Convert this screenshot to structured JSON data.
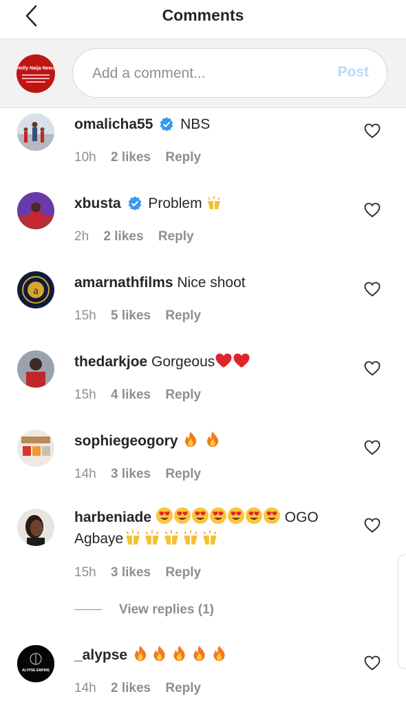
{
  "header": {
    "title": "Comments",
    "back_icon": "back-arrow-icon"
  },
  "compose": {
    "avatar_text": "Holly Naija News",
    "placeholder": "Add a comment...",
    "post_label": "Post",
    "post_color": "#b3dbff"
  },
  "comments": [
    {
      "username": "omalicha55",
      "verified": true,
      "text": "NBS",
      "emoji": [],
      "time": "10h",
      "likes": "2 likes",
      "reply": "Reply"
    },
    {
      "username": "xbusta",
      "verified": true,
      "text": "Problem",
      "emoji": [
        "raising-hands"
      ],
      "time": "2h",
      "likes": "2 likes",
      "reply": "Reply"
    },
    {
      "username": "amarnathfilms",
      "verified": false,
      "text": "Nice shoot",
      "emoji": [],
      "time": "15h",
      "likes": "5 likes",
      "reply": "Reply"
    },
    {
      "username": "thedarkjoe",
      "verified": false,
      "text": "Gorgeous",
      "emoji": [
        "red-heart",
        "red-heart"
      ],
      "time": "15h",
      "likes": "4 likes",
      "reply": "Reply"
    },
    {
      "username": "sophiegeogory",
      "verified": false,
      "text": "",
      "emoji": [
        "fire",
        "fire"
      ],
      "time": "14h",
      "likes": "3 likes",
      "reply": "Reply"
    },
    {
      "username": "harbeniade",
      "verified": false,
      "text_after_emoji": "OGO",
      "text_line2": "Agbaye",
      "emoji": [
        "heart-eyes",
        "heart-eyes",
        "heart-eyes",
        "heart-eyes",
        "heart-eyes",
        "heart-eyes",
        "heart-eyes"
      ],
      "emoji_line2": [
        "raising-hands",
        "raising-hands",
        "raising-hands",
        "raising-hands",
        "raising-hands"
      ],
      "time": "15h",
      "likes": "3 likes",
      "reply": "Reply",
      "view_replies": "View replies (1)"
    },
    {
      "username": "_alypse",
      "verified": false,
      "text": "",
      "emoji": [
        "fire",
        "fire",
        "fire",
        "fire",
        "fire"
      ],
      "time": "14h",
      "likes": "2 likes",
      "reply": "Reply",
      "avatar_text": "ALYPSE EMPIRE"
    }
  ],
  "colors": {
    "verified": "#3897f0",
    "muted": "#8e8e8e",
    "heart_red": "#e0242b"
  }
}
